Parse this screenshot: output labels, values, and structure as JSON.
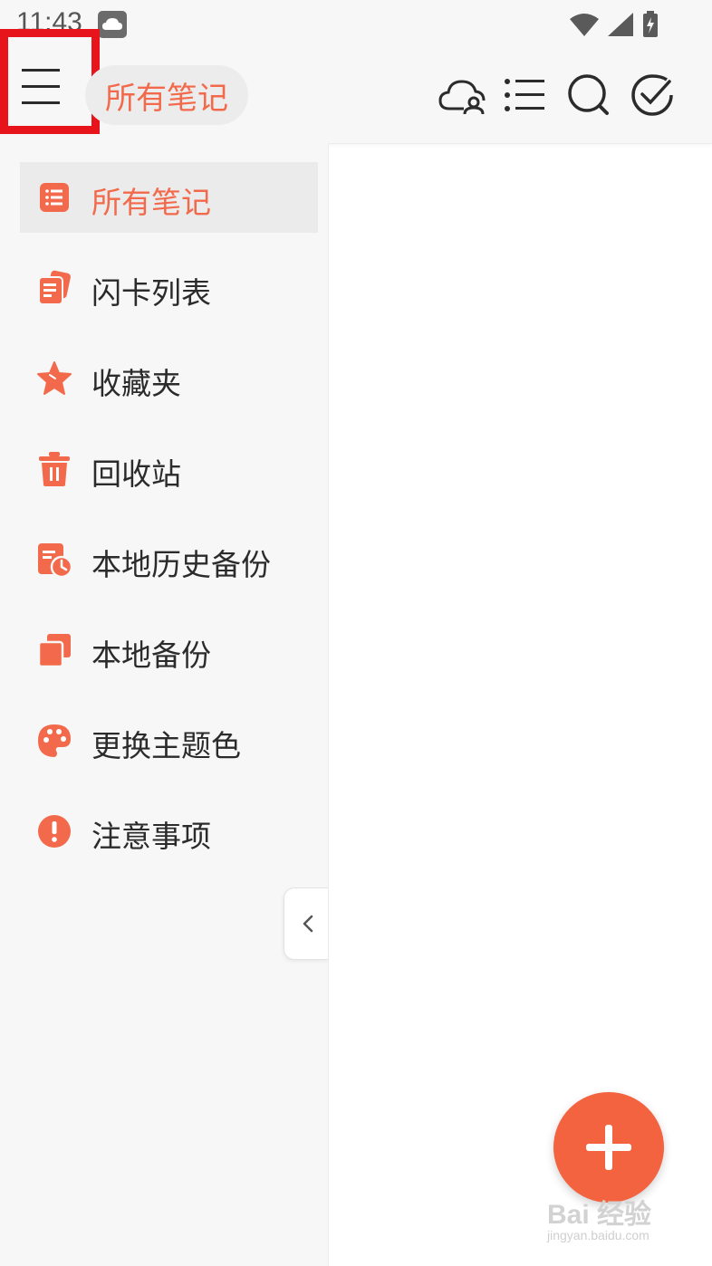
{
  "status_bar": {
    "time": "11:43",
    "icons": [
      "weather-cloud-icon",
      "wifi-icon",
      "signal-icon",
      "battery-charging-icon"
    ]
  },
  "toolbar": {
    "current_folder": "所有笔记",
    "icons": [
      "menu-icon",
      "cloud-account-icon",
      "list-view-icon",
      "search-icon",
      "select-check-icon"
    ]
  },
  "drawer": {
    "items": [
      {
        "label": "所有笔记",
        "icon": "notes-list-icon",
        "active": true
      },
      {
        "label": "闪卡列表",
        "icon": "flashcards-icon",
        "active": false
      },
      {
        "label": "收藏夹",
        "icon": "star-icon",
        "active": false
      },
      {
        "label": "回收站",
        "icon": "trash-icon",
        "active": false
      },
      {
        "label": "本地历史备份",
        "icon": "history-backup-icon",
        "active": false
      },
      {
        "label": "本地备份",
        "icon": "backup-copies-icon",
        "active": false
      },
      {
        "label": "更换主题色",
        "icon": "palette-icon",
        "active": false
      },
      {
        "label": "注意事项",
        "icon": "alert-icon",
        "active": false
      }
    ]
  },
  "fab": {
    "icon": "plus-icon"
  },
  "watermark": {
    "text": "Bai 经验",
    "sub": "jingyan.baidu.com"
  },
  "colors": {
    "accent": "#f26a4b",
    "fab": "#f4633f",
    "highlight_box": "#e8141c",
    "drawer_bg": "#f7f7f7"
  }
}
